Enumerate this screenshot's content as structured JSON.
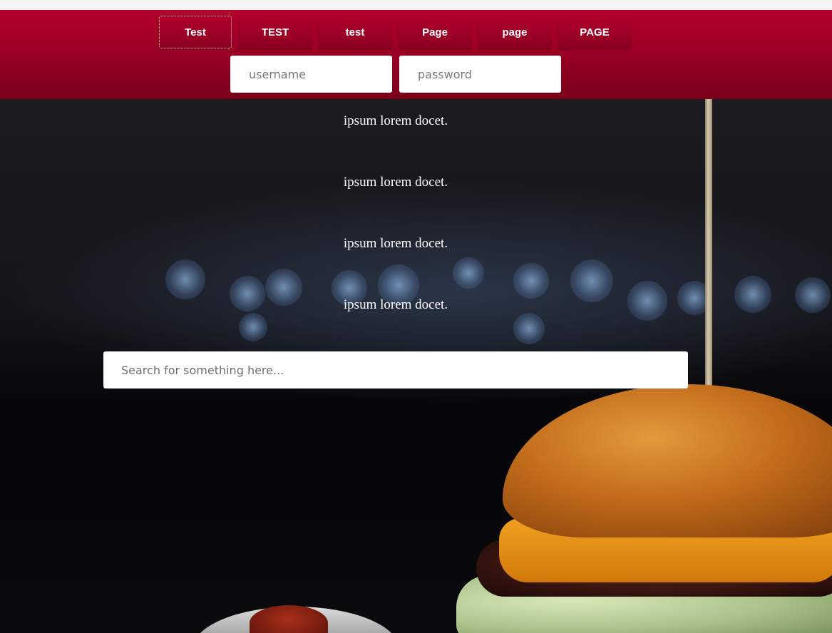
{
  "nav": {
    "items": [
      {
        "label": "Test"
      },
      {
        "label": "TEST"
      },
      {
        "label": "test"
      },
      {
        "label": "Page"
      },
      {
        "label": "page"
      },
      {
        "label": "PAGE"
      }
    ],
    "active_index": 0
  },
  "login": {
    "username_placeholder": "username",
    "password_placeholder": "password"
  },
  "hero": {
    "lines": [
      "ipsum lorem docet.",
      "ipsum lorem docet.",
      "ipsum lorem docet.",
      "ipsum lorem docet."
    ]
  },
  "search": {
    "placeholder": "Search for something here..."
  },
  "colors": {
    "header_red": "#a00026",
    "header_red_dark": "#7a0019",
    "text_on_dark": "#ffffff"
  }
}
